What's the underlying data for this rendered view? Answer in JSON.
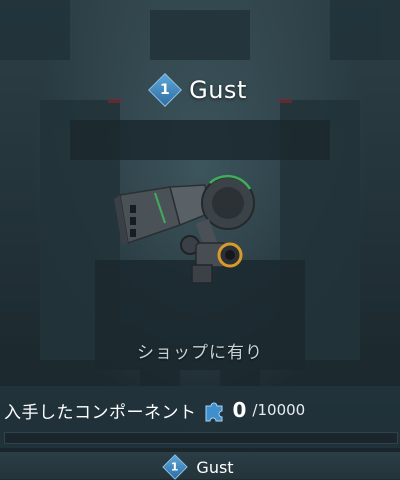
{
  "item": {
    "level": "1",
    "name": "Gust",
    "availability": "ショップに有り"
  },
  "components": {
    "label": "入手したコンポーネント",
    "current": "0",
    "total": "/10000",
    "progress_fraction": 0
  },
  "footer": {
    "level": "1",
    "name": "Gust"
  },
  "icons": {
    "level_badge": "diamond-badge-icon",
    "component": "puzzle-piece-icon",
    "weapon": "gust-weapon-icon"
  },
  "colors": {
    "accent": "#4aa3d8",
    "badge": "#3f87bf"
  }
}
